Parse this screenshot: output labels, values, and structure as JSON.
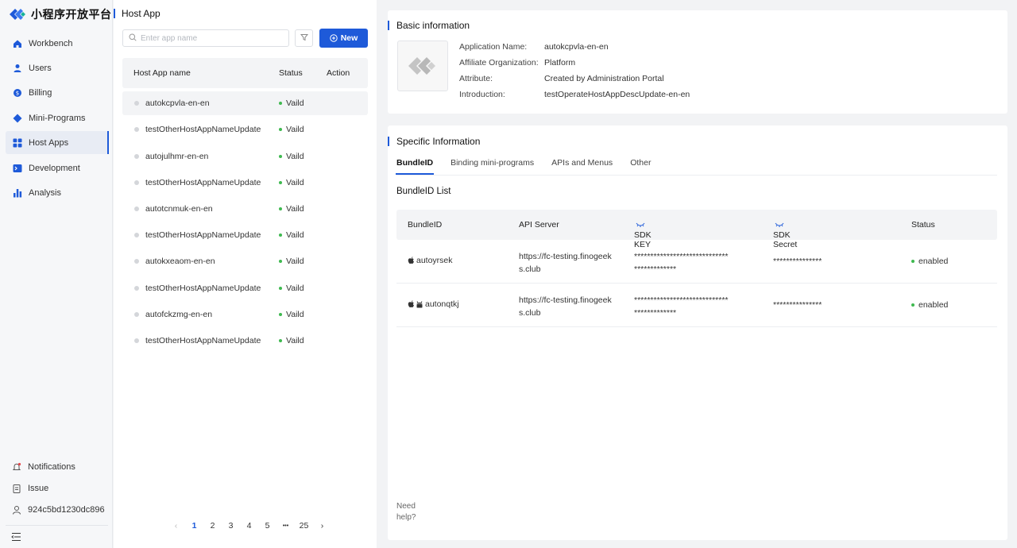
{
  "brand": {
    "name": "小程序开放平台",
    "accent": "#1e5ad9"
  },
  "sidebar": {
    "items": [
      {
        "label": "Workbench",
        "icon": "home-icon"
      },
      {
        "label": "Users",
        "icon": "user-icon"
      },
      {
        "label": "Billing",
        "icon": "billing-icon"
      },
      {
        "label": "Mini-Programs",
        "icon": "diamond-icon"
      },
      {
        "label": "Host Apps",
        "icon": "grid-icon",
        "active": true
      },
      {
        "label": "Development",
        "icon": "terminal-icon"
      },
      {
        "label": "Analysis",
        "icon": "bar-chart-icon"
      }
    ],
    "bottom": [
      {
        "label": "Notifications",
        "icon": "bell-icon"
      },
      {
        "label": "Issue",
        "icon": "clipboard-icon"
      },
      {
        "label": "924c5bd1230dc896",
        "icon": "person-icon"
      }
    ]
  },
  "list": {
    "title": "Host App",
    "search_placeholder": "Enter app name",
    "new_label": "New",
    "columns": [
      "Host App name",
      "Status",
      "Action"
    ],
    "rows": [
      {
        "name": "autokcpvla-en-en",
        "status": "Vaild"
      },
      {
        "name": "testOtherHostAppNameUpdate",
        "status": "Vaild"
      },
      {
        "name": "autojulhmr-en-en",
        "status": "Vaild"
      },
      {
        "name": "testOtherHostAppNameUpdate",
        "status": "Vaild"
      },
      {
        "name": "autotcnmuk-en-en",
        "status": "Vaild"
      },
      {
        "name": "testOtherHostAppNameUpdate",
        "status": "Vaild"
      },
      {
        "name": "autokxeaom-en-en",
        "status": "Vaild"
      },
      {
        "name": "testOtherHostAppNameUpdate",
        "status": "Vaild"
      },
      {
        "name": "autofckzmg-en-en",
        "status": "Vaild"
      },
      {
        "name": "testOtherHostAppNameUpdate",
        "status": "Vaild"
      }
    ],
    "pagination": {
      "pages": [
        "1",
        "2",
        "3",
        "4",
        "5"
      ],
      "ellipsis": "•••",
      "last": "25",
      "current": "1"
    }
  },
  "basic": {
    "title": "Basic information",
    "fields": [
      {
        "key": "Application Name:",
        "value": "autokcpvla-en-en"
      },
      {
        "key": "Affiliate Organization:",
        "value": "Platform"
      },
      {
        "key": "Attribute:",
        "value": "Created by Administration Portal"
      },
      {
        "key": "Introduction:",
        "value": "testOperateHostAppDescUpdate-en-en"
      }
    ]
  },
  "specific": {
    "title": "Specific Information",
    "tabs": [
      "BundleID",
      "Binding mini-programs",
      "APIs and Menus",
      "Other"
    ],
    "active_tab": "BundleID",
    "list_title": "BundleID List",
    "columns": [
      "BundleID",
      "API Server",
      "SDK KEY",
      "SDK Secret",
      "Status"
    ],
    "rows": [
      {
        "bundle": "autoyrsek",
        "server1": "https://fc-testing.finogeek",
        "server2": "s.club",
        "key1": "*****************************",
        "key2": "*************",
        "secret": "***************",
        "status": "enabled",
        "android": false
      },
      {
        "bundle": "autonqtkj",
        "server1": "https://fc-testing.finogeek",
        "server2": "s.club",
        "key1": "*****************************",
        "key2": "*************",
        "secret": "***************",
        "status": "enabled",
        "android": true
      }
    ],
    "need_help": "Need help?"
  }
}
